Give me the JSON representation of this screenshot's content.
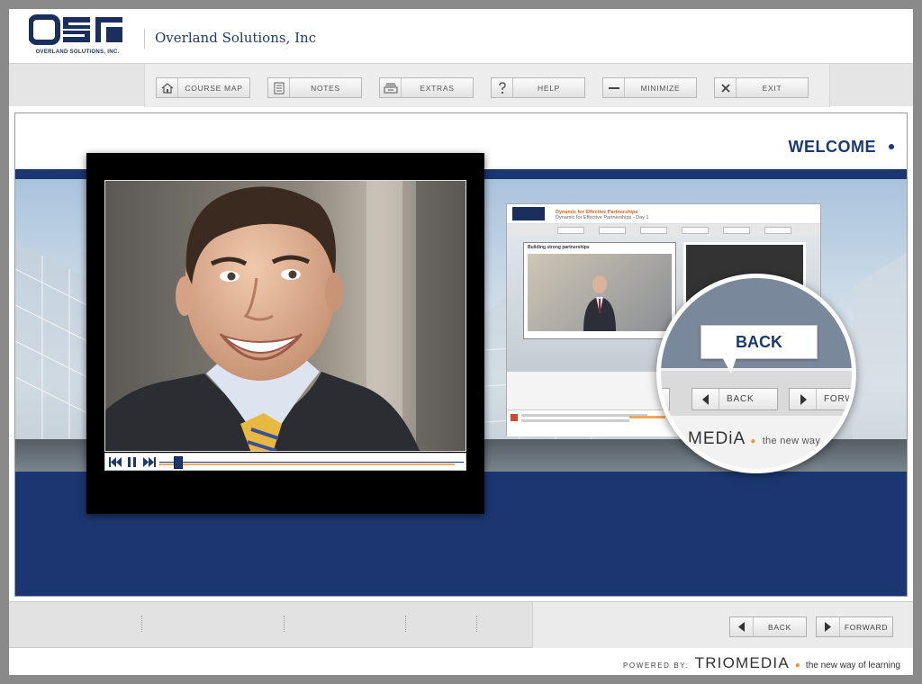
{
  "header": {
    "logo_text": "QSI",
    "logo_subtitle": "OVERLAND SOLUTIONS, INC.",
    "company_name": "Overland Solutions, Inc"
  },
  "toolbar": {
    "buttons": [
      {
        "label": "COURSE MAP",
        "icon": "home-icon"
      },
      {
        "label": "NOTES",
        "icon": "notes-icon"
      },
      {
        "label": "EXTRAS",
        "icon": "extras-icon"
      },
      {
        "label": "HELP",
        "icon": "help-icon"
      },
      {
        "label": "MINIMIZE",
        "icon": "minimize-icon"
      },
      {
        "label": "EXIT",
        "icon": "close-icon"
      }
    ]
  },
  "main": {
    "heading": "WELCOME",
    "preview": {
      "title": "Dynamic for Effective Partnerships",
      "subtitle": "Dynamic for Effective Partnerships - Day 1",
      "section_label": "Building strong partnerships"
    },
    "magnifier": {
      "tooltip": "BACK",
      "back_label": "BACK",
      "forward_label": "FORW",
      "brand": "MEDiA",
      "tagline": "the new way"
    }
  },
  "player": {
    "progress": 0.05,
    "buffered": 0.97,
    "buttons": [
      "rewind-icon",
      "pause-icon",
      "fast-forward-icon"
    ]
  },
  "navigation": {
    "back_label": "BACK",
    "forward_label": "FORWARD"
  },
  "footer": {
    "powered_by": "POWERED BY:",
    "brand": "TRIOMEDIA",
    "tagline": "the new way of learning"
  },
  "colors": {
    "navy": "#1b3670",
    "accent_orange": "#f0a85a",
    "text_blue": "#1f3a6e"
  }
}
